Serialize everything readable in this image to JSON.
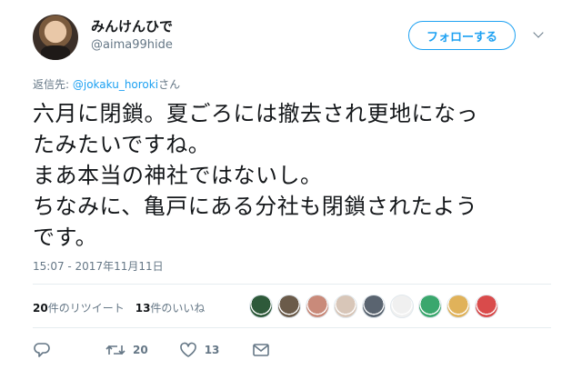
{
  "user": {
    "display_name": "みんけんひで",
    "handle": "@aima99hide"
  },
  "follow_button_label": "フォローする",
  "reply": {
    "prefix": "返信先: ",
    "mention": "@jokaku_horoki",
    "suffix": "さん"
  },
  "tweet": {
    "lines": [
      "六月に閉鎖。夏ごろには撤去され更地になっ",
      "たみたいですね。",
      "まあ本当の神社ではないし。",
      "ちなみに、亀戸にある分社も閉鎖されたよう",
      "です。"
    ]
  },
  "timestamp": "15:07 - 2017年11月11日",
  "stats": {
    "retweet_count": "20",
    "retweet_label": "件のリツイート",
    "like_count": "13",
    "like_label": "件のいいね"
  },
  "likers": [
    {
      "color": "#2e5a3a"
    },
    {
      "color": "#6b5b4a"
    },
    {
      "color": "#c98a7a"
    },
    {
      "color": "#d8c6b8"
    },
    {
      "color": "#5a6470"
    },
    {
      "color": "#f0f0f0"
    },
    {
      "color": "#3aa76d"
    },
    {
      "color": "#e0b25a"
    },
    {
      "color": "#d94b4b"
    }
  ],
  "actions": {
    "retweet_count": "20",
    "like_count": "13"
  },
  "colors": {
    "accent": "#1da1f2",
    "secondary_text": "#657786",
    "divider": "#e6ecf0"
  }
}
